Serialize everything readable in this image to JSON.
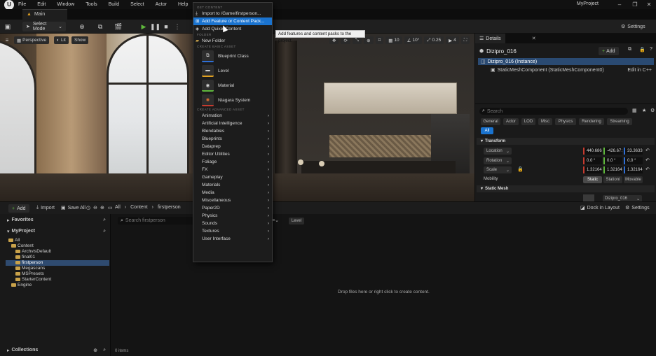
{
  "menubar": {
    "items": [
      "File",
      "Edit",
      "Window",
      "Tools",
      "Build",
      "Select",
      "Actor",
      "Help"
    ],
    "project": "MyProject"
  },
  "tabs": {
    "main": "Main"
  },
  "toolbar": {
    "select_mode": "Select Mode",
    "settings": "Settings"
  },
  "viewport": {
    "perspective": "Perspective",
    "lit": "Lit",
    "show": "Show",
    "grid": "10",
    "angle": "10°",
    "scale": "0.25",
    "camera": "4"
  },
  "details": {
    "tab": "Details",
    "object_name": "Dizipro_016",
    "add": "Add",
    "instance": "Dizipro_016 (Instance)",
    "component": "StaticMeshComponent (StaticMeshComponent0)",
    "edit_cpp": "Edit in C++",
    "search_placeholder": "Search",
    "filters": [
      "General",
      "Actor",
      "LOD",
      "Misc",
      "Physics",
      "Rendering",
      "Streaming",
      "All"
    ],
    "transform_title": "Transform",
    "location_label": "Location",
    "rotation_label": "Rotation",
    "scale_label": "Scale",
    "mobility_label": "Mobility",
    "location": [
      "440.686",
      "-426.67:",
      "33.3633"
    ],
    "rotation": [
      "0.0 °",
      "0.0 °",
      "0.0 °"
    ],
    "scale": [
      "1.32164",
      "1.32164",
      "1.32164"
    ],
    "mobility": [
      "Static",
      "Stationi",
      "Movable"
    ],
    "static_mesh_title": "Static Mesh",
    "mesh_value": "Dizipro_016"
  },
  "content_browser": {
    "add": "Add",
    "import": "Import",
    "save_all": "Save All",
    "breadcrumb": [
      "All",
      "Content",
      "firstperson"
    ],
    "dock": "Dock in Layout",
    "settings": "Settings",
    "favorites": "Favorites",
    "project": "MyProject",
    "search_placeholder": "Search firstperson",
    "filter_chip": "Level",
    "tree": [
      "All",
      "Content",
      "ArchvisDefault",
      "final01",
      "firstperson",
      "Megascans",
      "MSPresets",
      "StarterContent",
      "Engine"
    ],
    "empty_hint": "Drop files here or right click to create content.",
    "collections": "Collections",
    "items_count": "0 items"
  },
  "dropdown": {
    "hdr_get": "GET CONTENT",
    "import_item": "Import to /Game/firstperson...",
    "add_feature": "Add Feature or Content Pack...",
    "add_quixel": "Add Quixel Content",
    "hdr_folder": "FOLDER",
    "new_folder": "New Folder",
    "hdr_basic": "CREATE BASIC ASSET",
    "basic": [
      "Blueprint Class",
      "Level",
      "Material",
      "Niagara System"
    ],
    "hdr_advanced": "CREATE ADVANCED ASSET",
    "advanced": [
      "Animation",
      "Artificial Intelligence",
      "Blendables",
      "Blueprints",
      "Dataprep",
      "Editor Utilities",
      "Foliage",
      "FX",
      "Gameplay",
      "Materials",
      "Media",
      "Miscellaneous",
      "Paper2D",
      "Physics",
      "Sounds",
      "Textures",
      "User Interface"
    ]
  },
  "tooltip": "Add features and content packs to the project.",
  "colors": {
    "accent": "#1a73cf",
    "folder": "#c9a24a",
    "axis_x": "#c53b2f",
    "play": "#5fb83c"
  }
}
